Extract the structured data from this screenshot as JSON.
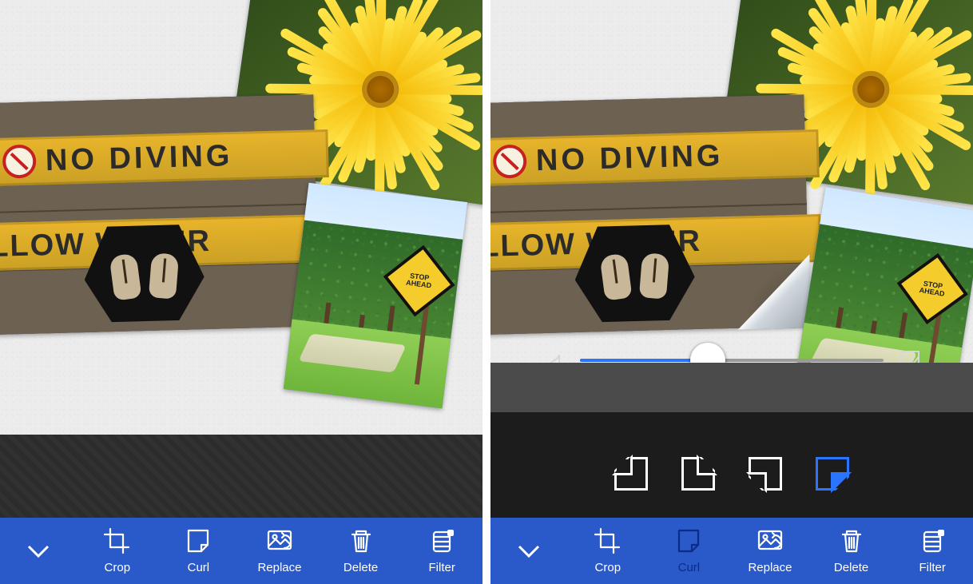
{
  "panes": {
    "left": {
      "toolbar": {
        "items": [
          {
            "id": "crop",
            "label": "Crop",
            "icon": "crop-icon",
            "active": false
          },
          {
            "id": "curl",
            "label": "Curl",
            "icon": "curl-icon",
            "active": false
          },
          {
            "id": "replace",
            "label": "Replace",
            "icon": "replace-icon",
            "active": false
          },
          {
            "id": "delete",
            "label": "Delete",
            "icon": "delete-icon",
            "active": false
          },
          {
            "id": "filter",
            "label": "Filter",
            "icon": "filter-icon",
            "active": false
          }
        ]
      },
      "sign_photo": {
        "line1": "NO DIVING",
        "line2": "ALLOW WATER"
      },
      "park_photo": {
        "sign_text": "STOP AHEAD"
      }
    },
    "right": {
      "toolbar": {
        "items": [
          {
            "id": "crop",
            "label": "Crop",
            "icon": "crop-icon",
            "active": false
          },
          {
            "id": "curl",
            "label": "Curl",
            "icon": "curl-icon",
            "active": true
          },
          {
            "id": "replace",
            "label": "Replace",
            "icon": "replace-icon",
            "active": false
          },
          {
            "id": "delete",
            "label": "Delete",
            "icon": "delete-icon",
            "active": false
          },
          {
            "id": "filter",
            "label": "Filter",
            "icon": "filter-icon",
            "active": false
          }
        ]
      },
      "curl_panel": {
        "slider": {
          "min": 0,
          "max": 100,
          "value": 42
        },
        "corner_options": [
          "top-left",
          "top-right",
          "bottom-left",
          "bottom-right"
        ],
        "selected_corner": "bottom-right"
      },
      "sign_photo": {
        "line1": "NO DIVING",
        "line2": "ALLOW WATER",
        "curl_corner": "bottom-right"
      },
      "park_photo": {
        "sign_text": "STOP AHEAD"
      }
    }
  },
  "colors": {
    "toolbar": "#2a59c9",
    "accent": "#2a74ff"
  }
}
